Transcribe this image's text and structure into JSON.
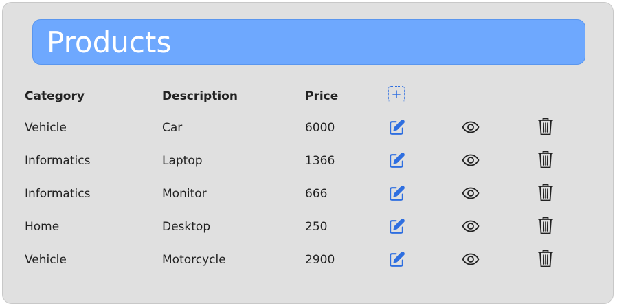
{
  "header": {
    "title": "Products"
  },
  "table": {
    "columns": {
      "category": "Category",
      "description": "Description",
      "price": "Price"
    },
    "add_icon": "plus-square-icon",
    "row_icons": [
      "edit-icon",
      "eye-icon",
      "trash-icon"
    ],
    "rows": [
      {
        "category": "Vehicle",
        "description": "Car",
        "price": "6000"
      },
      {
        "category": "Informatics",
        "description": "Laptop",
        "price": "1366"
      },
      {
        "category": "Informatics",
        "description": "Monitor",
        "price": "666"
      },
      {
        "category": "Home",
        "description": "Desktop",
        "price": "250"
      },
      {
        "category": "Vehicle",
        "description": "Motorcycle",
        "price": "2900"
      }
    ]
  },
  "colors": {
    "accent": "#6ea8fe",
    "edit_icon": "#2f6fe0",
    "panel_bg": "#e0e0e0"
  }
}
